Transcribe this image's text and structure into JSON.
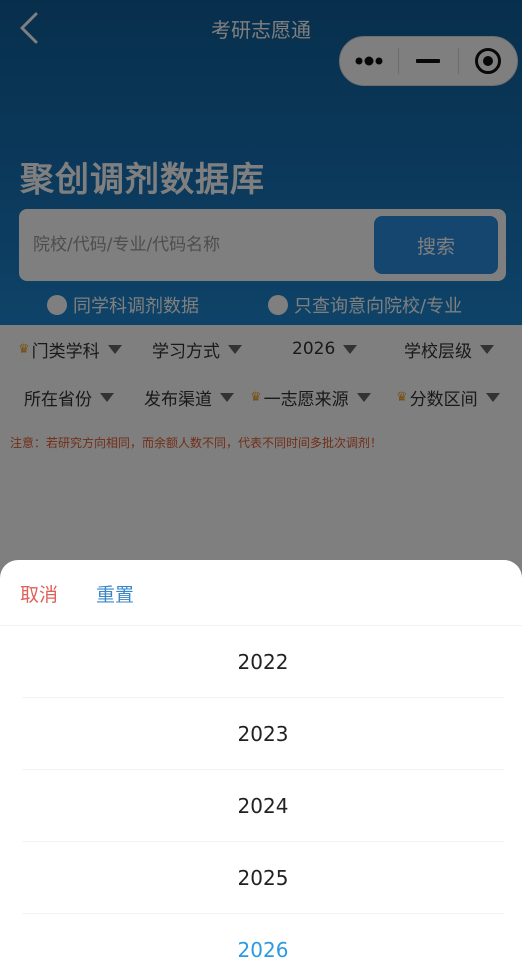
{
  "nav": {
    "title": "考研志愿通"
  },
  "capsule": {
    "more_icon": "more-dots-icon",
    "minimize_icon": "minimize-icon",
    "close_icon": "target-icon"
  },
  "hero": {
    "title": "聚创调剂数据库"
  },
  "search": {
    "placeholder": "院校/代码/专业/代码名称",
    "value": "",
    "button_label": "搜索"
  },
  "radios": [
    {
      "label": "同学科调剂数据",
      "checked": false
    },
    {
      "label": "只查询意向院校/专业",
      "checked": false
    }
  ],
  "filters": {
    "row1": [
      {
        "label": "门类学科",
        "crown": true
      },
      {
        "label": "学习方式",
        "crown": false
      },
      {
        "label": "2026",
        "crown": false
      },
      {
        "label": "学校层级",
        "crown": false
      }
    ],
    "row2": [
      {
        "label": "所在省份",
        "crown": false
      },
      {
        "label": "发布渠道",
        "crown": false
      },
      {
        "label": "一志愿来源",
        "crown": true
      },
      {
        "label": "分数区间",
        "crown": true
      }
    ]
  },
  "notice": "注意：若研究方向相同，而余额人数不同，代表不同时间多批次调剂！",
  "sheet": {
    "cancel_label": "取消",
    "reset_label": "重置",
    "options": [
      "2022",
      "2023",
      "2024",
      "2025",
      "2026"
    ],
    "selected": "2026"
  },
  "colors": {
    "header_blue": "#1773b8",
    "accent_blue": "#2a9be0",
    "cancel_red": "#e0605a",
    "notice_orange": "#e35d2f",
    "crown_gold": "#f0a020"
  }
}
